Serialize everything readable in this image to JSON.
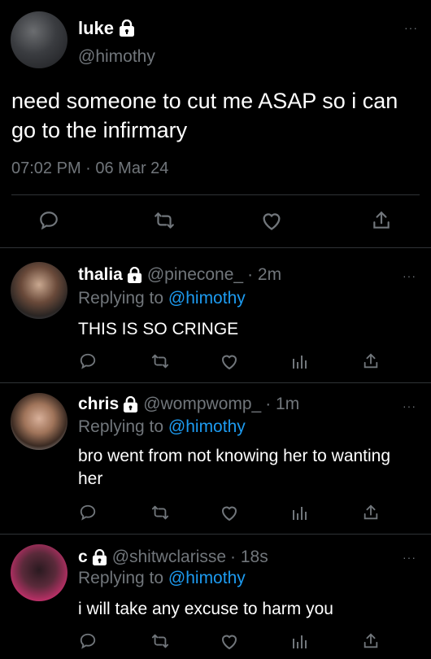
{
  "main_tweet": {
    "name": "luke",
    "handle": "@himothy",
    "text": "need someone to cut me ASAP so i can go to the infirmary",
    "timestamp": "07:02 PM · 06 Mar 24",
    "more": "···",
    "icons": [
      "lock-icon",
      "reply-icon",
      "retweet-icon",
      "like-icon",
      "share-icon"
    ]
  },
  "replies": [
    {
      "name": "thalia",
      "handle": "@pinecone_",
      "time": "· 2m",
      "replying_prefix": "Replying to ",
      "replying_to": "@himothy",
      "text": "THIS IS SO CRINGE",
      "more": "···"
    },
    {
      "name": "chris",
      "handle": "@wompwomp_",
      "time": "· 1m",
      "replying_prefix": "Replying to ",
      "replying_to": "@himothy",
      "text": "bro went from not knowing her to wanting her",
      "more": "···"
    },
    {
      "name": "c",
      "handle": "@shitwclarisse",
      "time": "· 18s",
      "replying_prefix": "Replying to ",
      "replying_to": "@himothy",
      "text": "i will take any excuse to harm you",
      "more": "···"
    }
  ],
  "colors": {
    "background": "#000000",
    "text": "#ffffff",
    "secondary": "#71767b",
    "link": "#1d9bf0",
    "divider": "#2f3336"
  }
}
